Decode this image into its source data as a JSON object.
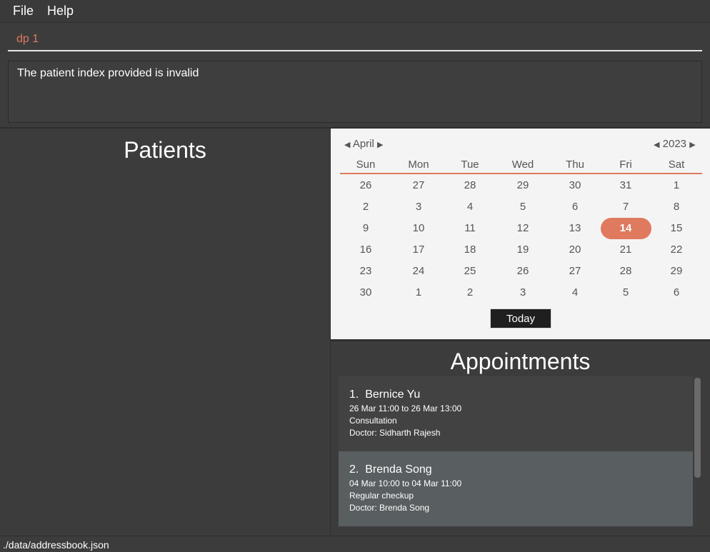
{
  "menu": {
    "file": "File",
    "help": "Help"
  },
  "command": {
    "value": "dp 1"
  },
  "result": {
    "message": "The patient index provided is invalid"
  },
  "patients": {
    "title": "Patients"
  },
  "calendar": {
    "month": "April",
    "year": "2023",
    "weekdays": [
      "Sun",
      "Mon",
      "Tue",
      "Wed",
      "Thu",
      "Fri",
      "Sat"
    ],
    "weeks": [
      [
        "26",
        "27",
        "28",
        "29",
        "30",
        "31",
        "1"
      ],
      [
        "2",
        "3",
        "4",
        "5",
        "6",
        "7",
        "8"
      ],
      [
        "9",
        "10",
        "11",
        "12",
        "13",
        "14",
        "15"
      ],
      [
        "16",
        "17",
        "18",
        "19",
        "20",
        "21",
        "22"
      ],
      [
        "23",
        "24",
        "25",
        "26",
        "27",
        "28",
        "29"
      ],
      [
        "30",
        "1",
        "2",
        "3",
        "4",
        "5",
        "6"
      ]
    ],
    "selected_day": "14",
    "today_label": "Today",
    "accent_color": "#e07a5f"
  },
  "appointments": {
    "title": "Appointments",
    "items": [
      {
        "index": "1.",
        "name": "Bernice Yu",
        "time": "26 Mar 11:00 to 26 Mar 13:00",
        "type": "Consultation",
        "doctor": "Doctor: Sidharth Rajesh"
      },
      {
        "index": "2.",
        "name": "Brenda Song",
        "time": "04 Mar 10:00 to 04 Mar 11:00",
        "type": "Regular checkup",
        "doctor": "Doctor: Brenda Song"
      }
    ]
  },
  "status": {
    "path": "./data/addressbook.json"
  }
}
